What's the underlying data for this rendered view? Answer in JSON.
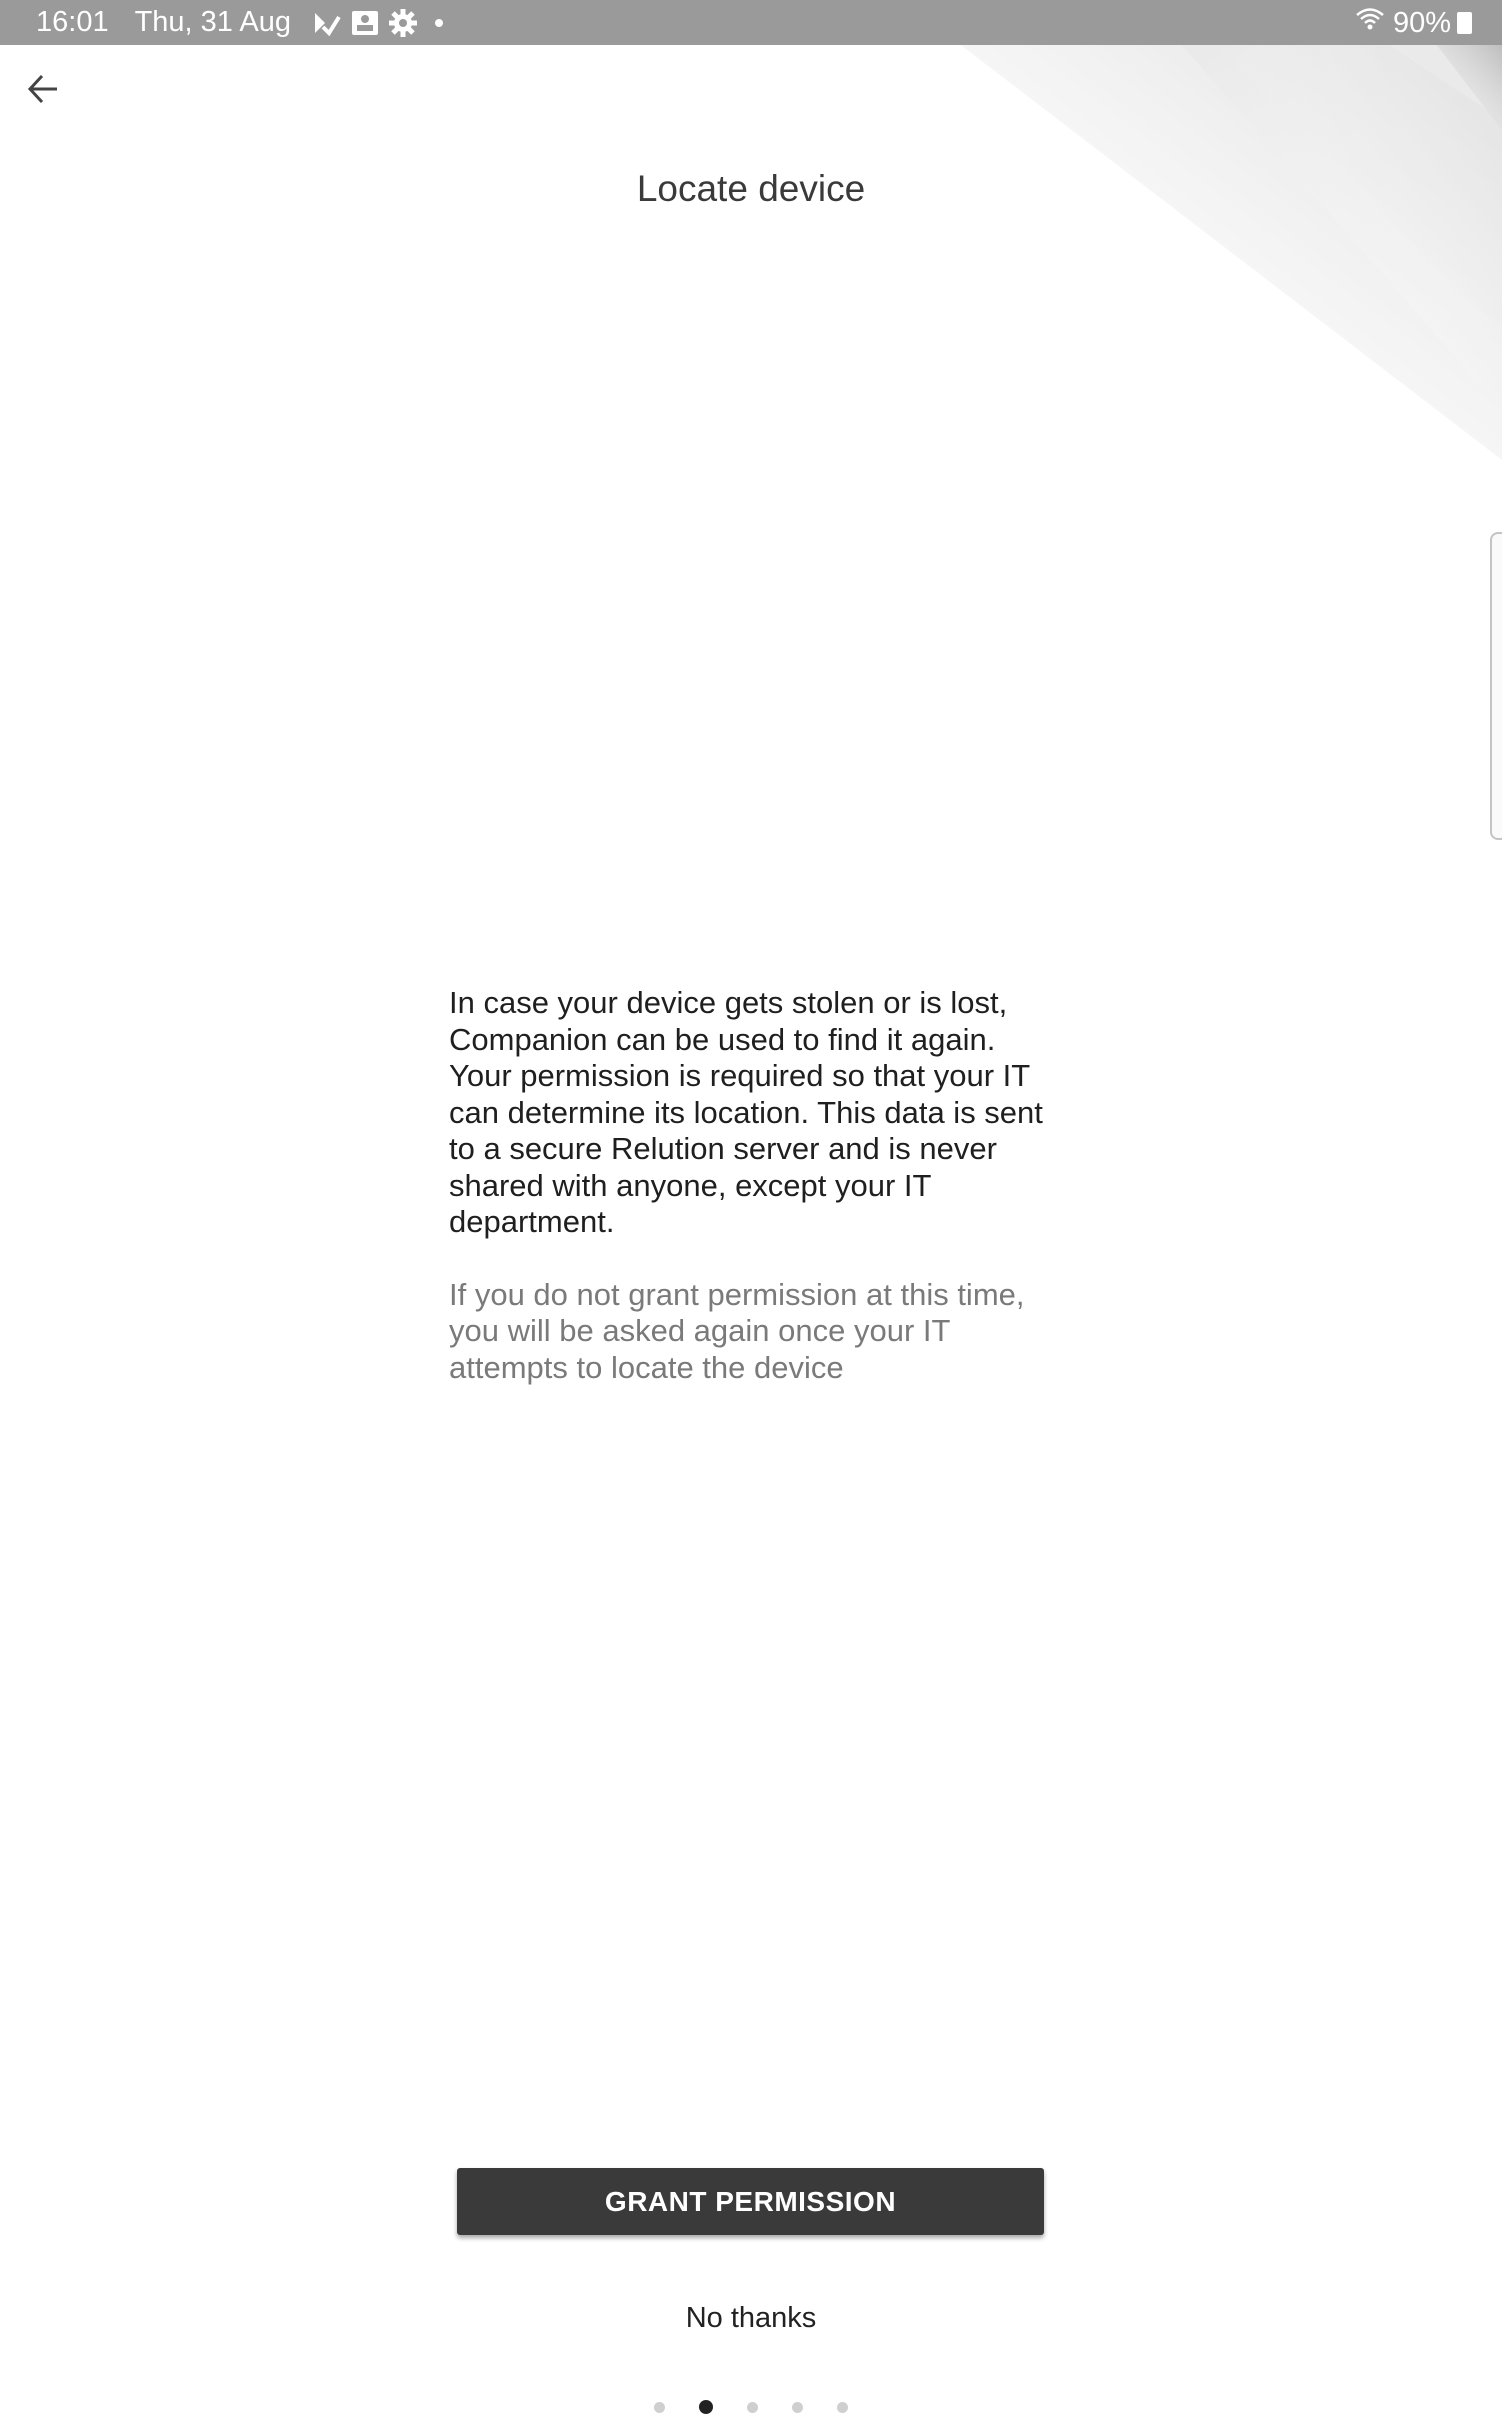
{
  "status_bar": {
    "time": "16:01",
    "date": "Thu, 31 Aug",
    "icons": [
      "pencil-check-icon",
      "image-notification-icon",
      "settings-gear-icon",
      "more-notifications-dot-icon"
    ],
    "wifi_icon": "wifi-icon",
    "battery_percent": "90%",
    "battery_icon": "battery-charging-icon"
  },
  "header": {
    "back_icon": "arrow-left-icon",
    "title": "Locate device"
  },
  "main": {
    "description": "In case your device gets stolen or is lost, Companion can be used to find it again. Your permission is required so that your IT can determine its location. This data is sent to a secure Relution server and is never shared with anyone, except your IT department.",
    "hint": "If you do not grant permission at this time, you will be asked again once your IT attempts to locate the device"
  },
  "actions": {
    "grant_label": "GRANT PERMISSION",
    "decline_label": "No thanks"
  },
  "pager": {
    "total": 5,
    "active_index": 1
  },
  "colors": {
    "status_bar": "#9a9a9a",
    "primary_button": "#3a3a3a",
    "hint_text": "#7a7a7a"
  }
}
